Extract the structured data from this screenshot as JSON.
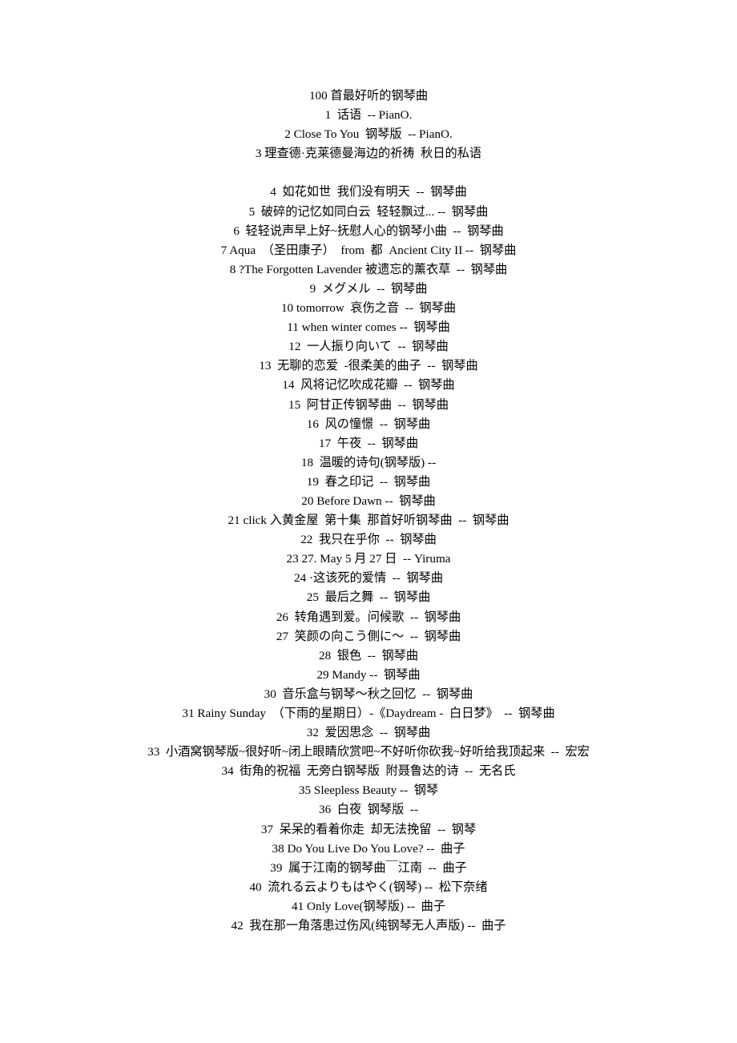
{
  "document": {
    "title": "100 首最好听的钢琴曲",
    "lines": [
      {
        "id": "title",
        "text": "100 首最好听的钢琴曲"
      },
      {
        "id": "item-1",
        "text": "1  话语  -- PianO."
      },
      {
        "id": "item-2",
        "text": "2 Close To You  钢琴版  -- PianO."
      },
      {
        "id": "item-3",
        "text": "3 理查德·克莱德曼海边的祈祷  秋日的私语"
      },
      {
        "id": "blank-1",
        "text": " "
      },
      {
        "id": "item-4",
        "text": "4  如花如世  我们没有明天  --  钢琴曲"
      },
      {
        "id": "item-5",
        "text": "5  破碎的记忆如同白云  轻轻飘过... --  钢琴曲"
      },
      {
        "id": "item-6",
        "text": "6  轻轻说声早上好~抚慰人心的钢琴小曲  --  钢琴曲"
      },
      {
        "id": "item-7",
        "text": "7 Aqua  （圣田康子）  from  都  Ancient City II --  钢琴曲"
      },
      {
        "id": "item-8",
        "text": "8 ?The Forgotten Lavender 被遗忘的薰衣草  --  钢琴曲"
      },
      {
        "id": "item-9",
        "text": "9  メグメル  --  钢琴曲"
      },
      {
        "id": "item-10",
        "text": "10 tomorrow  哀伤之音  --  钢琴曲"
      },
      {
        "id": "item-11",
        "text": "11 when winter comes --  钢琴曲"
      },
      {
        "id": "item-12",
        "text": "12  一人振り向いて  --  钢琴曲"
      },
      {
        "id": "item-13",
        "text": "13  无聊的恋爱  -很柔美的曲子  --  钢琴曲"
      },
      {
        "id": "item-14",
        "text": "14  风将记忆吹成花瓣  --  钢琴曲"
      },
      {
        "id": "item-15",
        "text": "15  阿甘正传钢琴曲  --  钢琴曲"
      },
      {
        "id": "item-16",
        "text": "16  风の憧憬  --  钢琴曲"
      },
      {
        "id": "item-17",
        "text": "17  午夜  --  钢琴曲"
      },
      {
        "id": "item-18",
        "text": "18  温暖的诗句(钢琴版) --"
      },
      {
        "id": "item-19",
        "text": "19  春之印记  --  钢琴曲"
      },
      {
        "id": "item-20",
        "text": "20 Before Dawn --  钢琴曲"
      },
      {
        "id": "item-21",
        "text": "21 click 入黄金屋  第十集  那首好听钢琴曲  --  钢琴曲"
      },
      {
        "id": "item-22",
        "text": "22  我只在乎你  --  钢琴曲"
      },
      {
        "id": "item-23",
        "text": "23 27. May 5 月 27 日  -- Yiruma"
      },
      {
        "id": "item-24",
        "text": "24 ·这该死的爱情  --  钢琴曲"
      },
      {
        "id": "item-25",
        "text": "25  最后之舞  --  钢琴曲"
      },
      {
        "id": "item-26",
        "text": "26  转角遇到爱。问候歌  --  钢琴曲"
      },
      {
        "id": "item-27",
        "text": "27  笑颜の向こう側に～  --  钢琴曲"
      },
      {
        "id": "item-28",
        "text": "28  银色  --  钢琴曲"
      },
      {
        "id": "item-29",
        "text": "29 Mandy --  钢琴曲"
      },
      {
        "id": "item-30",
        "text": "30  音乐盒与钢琴～秋之回忆  --  钢琴曲"
      },
      {
        "id": "item-31",
        "text": "31 Rainy Sunday  （下雨的星期日）-《Daydream -  白日梦》  --  钢琴曲"
      },
      {
        "id": "item-32",
        "text": "32  爱因思念  --  钢琴曲"
      },
      {
        "id": "item-33",
        "text": "33  小酒窝钢琴版~很好听~闭上眼睛欣赏吧~不好听你砍我~好听给我顶起来  --  宏宏"
      },
      {
        "id": "item-34",
        "text": "34  街角的祝福  无旁白钢琴版  附聂鲁达的诗  --  无名氏"
      },
      {
        "id": "item-35",
        "text": "35 Sleepless Beauty --  钢琴"
      },
      {
        "id": "item-36",
        "text": "36  白夜  钢琴版  --"
      },
      {
        "id": "item-37",
        "text": "37  呆呆的看着你走  却无法挽留  --  钢琴"
      },
      {
        "id": "item-38",
        "text": "38 Do You Live Do You Love? --  曲子"
      },
      {
        "id": "item-39",
        "text": "39  属于江南的钢琴曲￣江南  --  曲子"
      },
      {
        "id": "item-40",
        "text": "40  流れる云よりもはやく(钢琴) --  松下奈绪"
      },
      {
        "id": "item-41",
        "text": "41 Only Love(钢琴版) --  曲子"
      },
      {
        "id": "item-42",
        "text": "42  我在那一角落患过伤风(纯钢琴无人声版) --  曲子"
      }
    ]
  }
}
